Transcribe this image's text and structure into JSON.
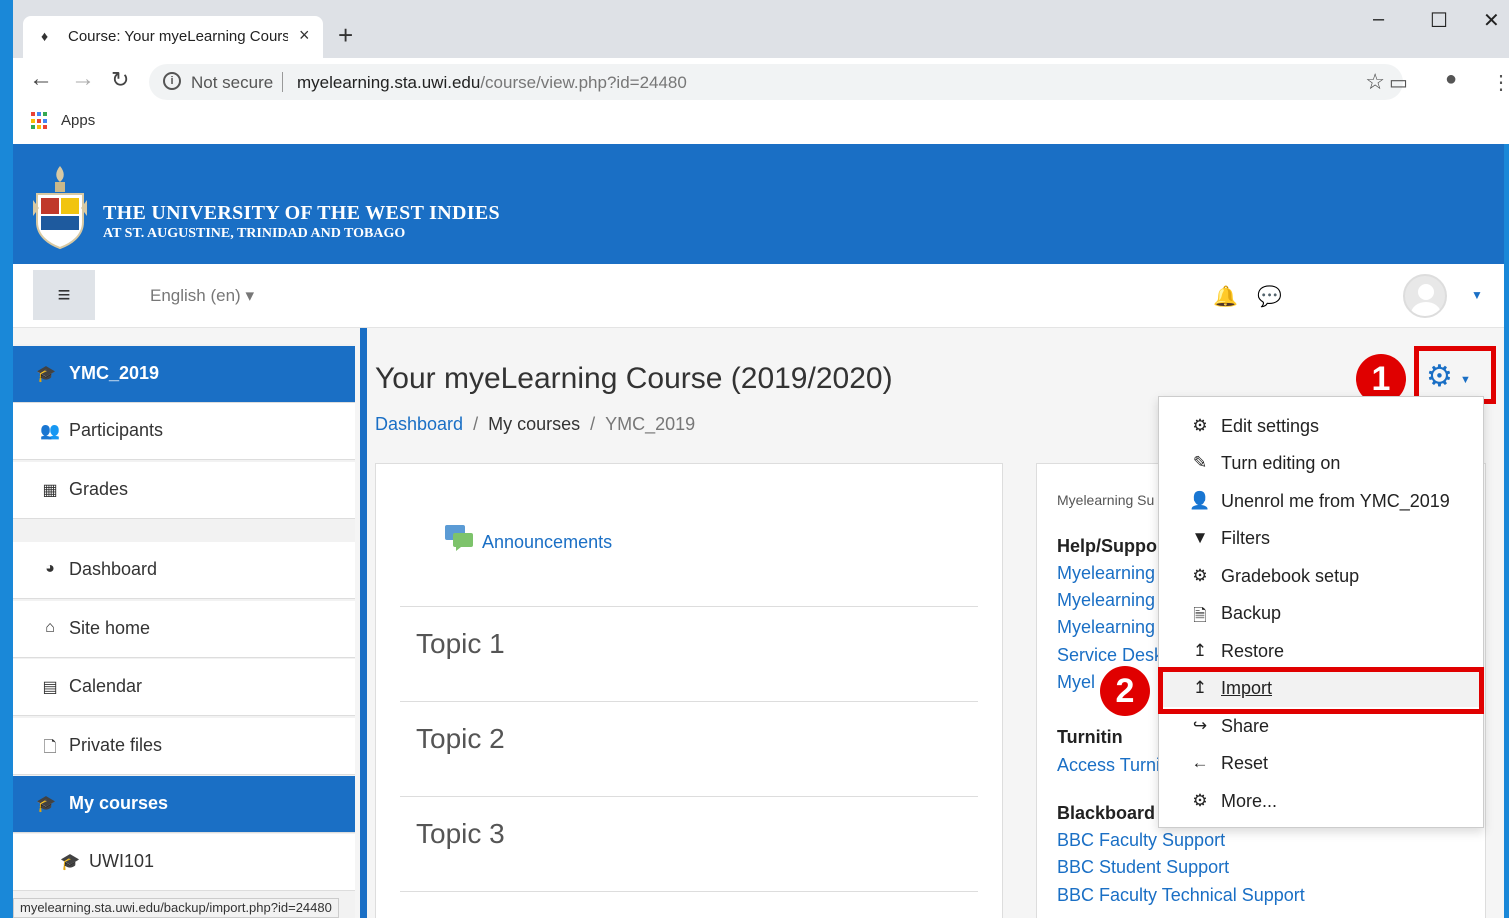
{
  "browser": {
    "tab_title": "Course: Your myeLearning Course",
    "address_secure": "Not secure",
    "address_host": "myelearning.sta.uwi.edu",
    "address_path": "/course/view.php?id=24480",
    "bookmark_apps": "Apps",
    "status_url": "myelearning.sta.uwi.edu/backup/import.php?id=24480"
  },
  "banner": {
    "university_name": "THE UNIVERSITY OF THE WEST INDIES",
    "university_sub": "AT ST. AUGUSTINE, TRINIDAD AND TOBAGO"
  },
  "navbar": {
    "language": "English (en)"
  },
  "sidebar": {
    "items": [
      {
        "label": "YMC_2019",
        "icon": "graduation-cap-icon"
      },
      {
        "label": "Participants",
        "icon": "users-icon"
      },
      {
        "label": "Grades",
        "icon": "table-icon"
      },
      {
        "label": "Dashboard",
        "icon": "dashboard-icon"
      },
      {
        "label": "Site home",
        "icon": "home-icon"
      },
      {
        "label": "Calendar",
        "icon": "calendar-icon"
      },
      {
        "label": "Private files",
        "icon": "file-icon"
      },
      {
        "label": "My courses",
        "icon": "graduation-cap-icon"
      },
      {
        "label": "UWI101",
        "icon": "graduation-cap-icon"
      }
    ]
  },
  "main": {
    "course_title": "Your myeLearning Course (2019/2020)",
    "breadcrumb": {
      "dashboard": "Dashboard",
      "my_courses": "My courses",
      "current": "YMC_2019",
      "separator": "/"
    },
    "announcements": "Announcements",
    "topics": [
      "Topic 1",
      "Topic 2",
      "Topic 3"
    ]
  },
  "block": {
    "small_title": "Myelearning Su",
    "help_heading": "Help/Suppo",
    "help_links": [
      "Myelearning",
      "Myelearning",
      "Myelearning",
      "Service Desk",
      "Myel"
    ],
    "turnitin_heading": "Turnitin",
    "turnitin_link": "Access Turni",
    "blackboard_heading": "Blackboard",
    "blackboard_links": [
      "BBC Faculty Support",
      "BBC Student Support",
      "BBC Faculty Technical Support"
    ]
  },
  "menu": {
    "items": [
      {
        "label": "Edit settings",
        "icon": "gear-icon"
      },
      {
        "label": "Turn editing on",
        "icon": "pencil-icon"
      },
      {
        "label": "Unenrol me from YMC_2019",
        "icon": "user-icon"
      },
      {
        "label": "Filters",
        "icon": "filter-icon"
      },
      {
        "label": "Gradebook setup",
        "icon": "gear-icon"
      },
      {
        "label": "Backup",
        "icon": "backup-file-icon"
      },
      {
        "label": "Restore",
        "icon": "upload-icon"
      },
      {
        "label": "Import",
        "icon": "upload-icon"
      },
      {
        "label": "Share",
        "icon": "share-icon"
      },
      {
        "label": "Reset",
        "icon": "arrow-left-icon"
      },
      {
        "label": "More...",
        "icon": "gear-icon"
      }
    ]
  },
  "annotations": {
    "step1": "1",
    "step2": "2",
    "highlight_color": "#e00000"
  },
  "colors": {
    "brand": "#1a6fc5",
    "desktop": "#1a88d8"
  }
}
